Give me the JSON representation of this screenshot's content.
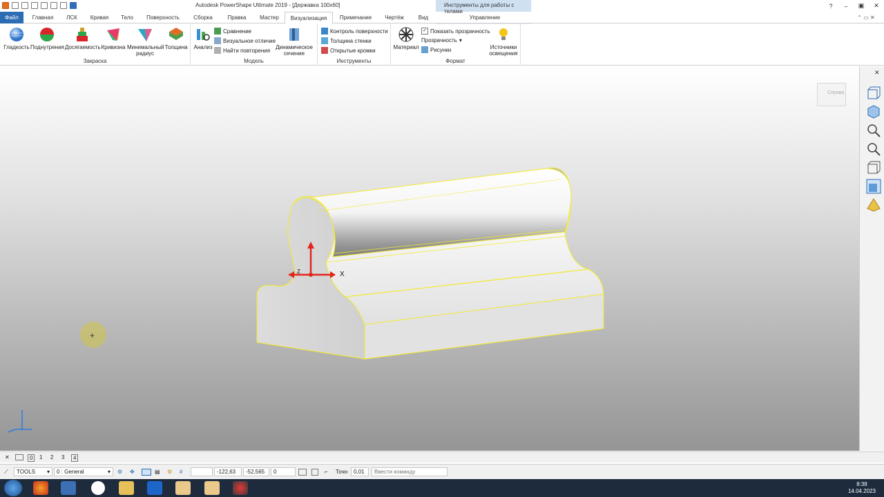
{
  "window": {
    "title": "Autodesk PowerShape Ultimate 2019 - [Державка 100x60]",
    "context_title": "Инструменты для работы с телами",
    "help": "?",
    "minimize": "–",
    "restore": "▣",
    "close": "✕"
  },
  "tabs": [
    {
      "label": "Файл"
    },
    {
      "label": "Главная"
    },
    {
      "label": "ЛСК"
    },
    {
      "label": "Кривая"
    },
    {
      "label": "Тело"
    },
    {
      "label": "Поверхность"
    },
    {
      "label": "Сборка"
    },
    {
      "label": "Правка"
    },
    {
      "label": "Мастер"
    },
    {
      "label": "Визуализация"
    },
    {
      "label": "Примечание"
    },
    {
      "label": "Чертёж"
    },
    {
      "label": "Вид"
    },
    {
      "label": "Управление"
    }
  ],
  "ribbon": {
    "shading": {
      "label": "Закраска",
      "buttons": [
        "Гладкость",
        "Поднутрения",
        "Досягаемость",
        "Кривизна",
        "Минимальный радиус",
        "Толщина"
      ]
    },
    "model": {
      "label": "Модель",
      "analysis": "Анализ",
      "compare": "Сравнение",
      "visual_diff": "Визуальное отличие",
      "find_repeats": "Найти повторения",
      "dynamic_section": "Динамическое сечение"
    },
    "tools": {
      "label": "Инструменты",
      "surface_check": "Контроль поверхности",
      "wall_thickness": "Толщина стенки",
      "open_edges": "Открытые кромки"
    },
    "format": {
      "label": "Формат",
      "material": "Материал",
      "show_transparency": "Показать прозрачность",
      "transparency": "Прозрачность",
      "pictures": "Рисунки",
      "light_sources": "Источники освещения"
    }
  },
  "viewport": {
    "axis_x": "X",
    "axis_z": "Z",
    "view_cube_label": "Справа"
  },
  "status1": {
    "views": [
      "0",
      "1",
      "2",
      "3",
      "4"
    ]
  },
  "status2": {
    "level_name": "TOOLS",
    "layer": "0 : General",
    "coord_x": "-122,63",
    "coord_y": "-52,565",
    "coord_z": "0",
    "points_label": "Точн",
    "points_value": "0,01",
    "command_placeholder": "Ввести команду"
  },
  "taskbar": {
    "time": "8:38",
    "date": "14.04.2023"
  },
  "colors": {
    "accent": "#2b6cb4",
    "edge_highlight": "#f3ea2e",
    "axis_red": "#e2241d",
    "taskbar": "#1d2b3d"
  }
}
